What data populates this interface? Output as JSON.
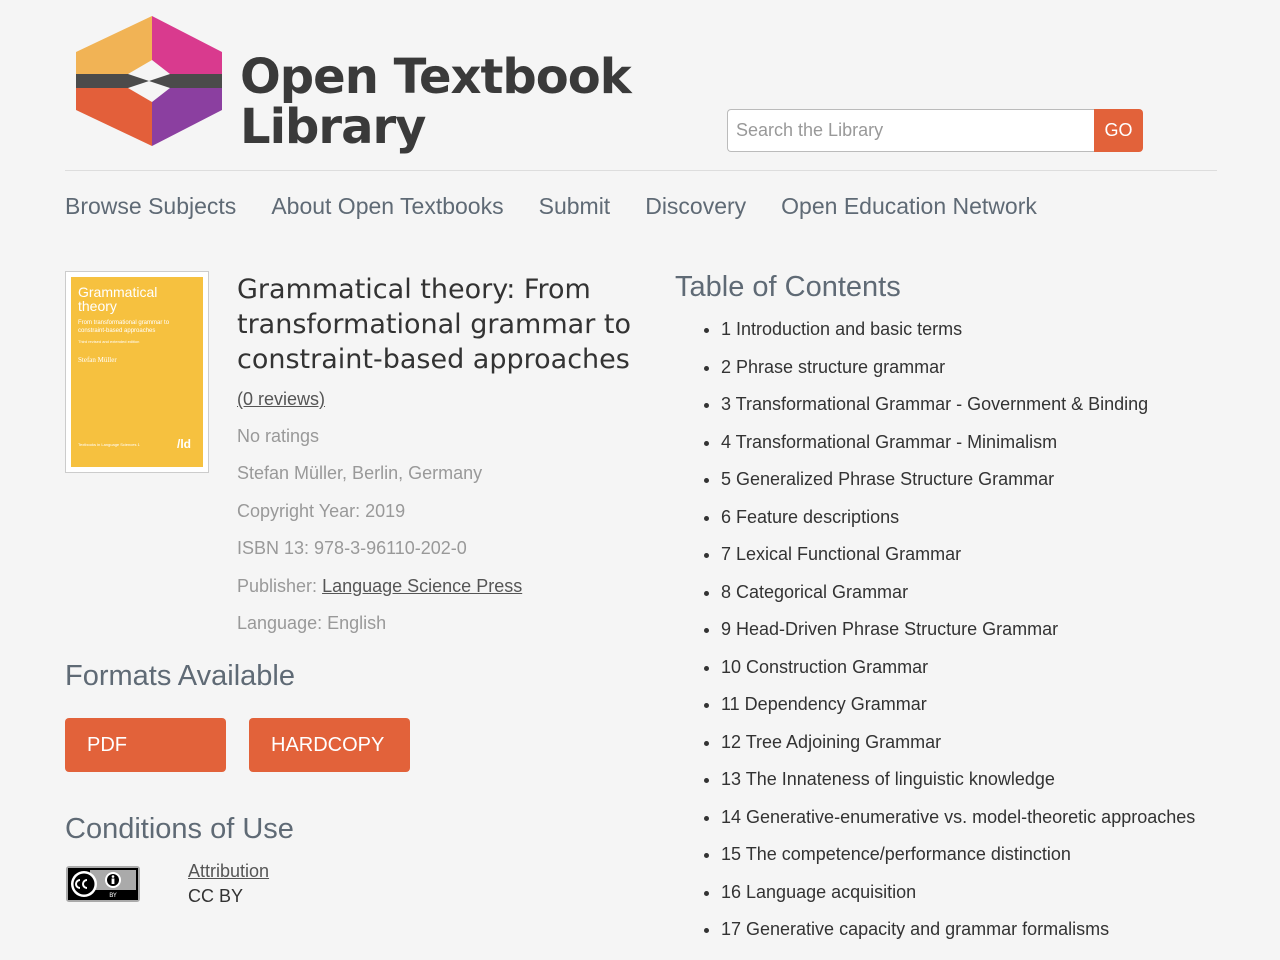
{
  "brand": {
    "name_line1": "Open Textbook",
    "name_line2": "Library"
  },
  "search": {
    "placeholder": "Search the Library",
    "button_label": "GO"
  },
  "nav": [
    "Browse Subjects",
    "About Open Textbooks",
    "Submit",
    "Discovery",
    "Open Education Network"
  ],
  "book": {
    "cover": {
      "title": "Grammatical theory",
      "subtitle": "From transformational grammar to constraint-based approaches",
      "edition": "Third revised and extended edition",
      "author": "Stefan Müller",
      "series": "Textbooks in Language Sciences 1",
      "logo": "/ld"
    },
    "title": "Grammatical theory: From transformational grammar to constraint-based approaches",
    "reviews": "(0 reviews)",
    "ratings": "No ratings",
    "author": "Stefan Müller, Berlin, Germany",
    "copyright": "Copyright Year: 2019",
    "isbn": "ISBN 13: 978-3-96110-202-0",
    "publisher_label": "Publisher:",
    "publisher": "Language Science Press",
    "language": "Language: English"
  },
  "formats": {
    "heading": "Formats Available",
    "items": [
      "PDF",
      "HARDCOPY"
    ]
  },
  "conditions": {
    "heading": "Conditions of Use",
    "license_link": "Attribution",
    "license_code": "CC BY",
    "badge_text": "BY"
  },
  "toc": {
    "heading": "Table of Contents",
    "items": [
      "1 Introduction and basic terms",
      "2 Phrase structure grammar",
      "3 Transformational Grammar - Government & Binding",
      "4 Transformational Grammar - Minimalism",
      "5 Generalized Phrase Structure Grammar",
      "6 Feature descriptions",
      "7 Lexical Functional Grammar",
      "8 Categorical Grammar",
      "9 Head-Driven Phrase Structure Grammar",
      "10 Construction Grammar",
      "11 Dependency Grammar",
      "12 Tree Adjoining Grammar",
      "13 The Innateness of linguistic knowledge",
      "14 Generative-enumerative vs. model-theoretic approaches",
      "15 The competence/performance distinction",
      "16 Language acquisition",
      "17 Generative capacity and grammar formalisms"
    ]
  },
  "colors": {
    "accent": "#e2623a",
    "logo_yellow": "#f1b355",
    "logo_pink": "#d93a8e",
    "logo_purple": "#8b3fa0",
    "logo_orange": "#e35f3a"
  }
}
